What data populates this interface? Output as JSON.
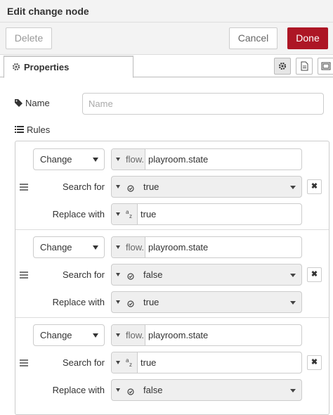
{
  "header": {
    "title": "Edit change node"
  },
  "toolbar": {
    "delete_label": "Delete",
    "cancel_label": "Cancel",
    "done_label": "Done"
  },
  "tabs": {
    "properties_label": "Properties"
  },
  "form": {
    "name_label": "Name",
    "name_placeholder": "Name",
    "rules_label": "Rules"
  },
  "rules": [
    {
      "action": "Change",
      "target_prefix": "flow.",
      "target_value": "playroom.state",
      "search_label": "Search for",
      "search_type": "boolean",
      "search_value": "true",
      "replace_label": "Replace with",
      "replace_type": "string",
      "replace_prefix": "az",
      "replace_value": "true"
    },
    {
      "action": "Change",
      "target_prefix": "flow.",
      "target_value": "playroom.state",
      "search_label": "Search for",
      "search_type": "boolean",
      "search_value": "false",
      "replace_label": "Replace with",
      "replace_type": "boolean",
      "replace_value": "true"
    },
    {
      "action": "Change",
      "target_prefix": "flow.",
      "target_value": "playroom.state",
      "search_label": "Search for",
      "search_type": "string",
      "search_prefix": "az",
      "search_value": "true",
      "replace_label": "Replace with",
      "replace_type": "boolean",
      "replace_value": "false"
    }
  ],
  "colors": {
    "done_button": "#ad1625",
    "header_bg": "#f3f3f3"
  },
  "icons": [
    "gear-icon",
    "description-icon",
    "appearance-icon",
    "tag-icon",
    "list-icon",
    "drag-handle-icon",
    "close-icon",
    "boolean-type-icon",
    "string-type-icon",
    "caret-down-icon"
  ]
}
